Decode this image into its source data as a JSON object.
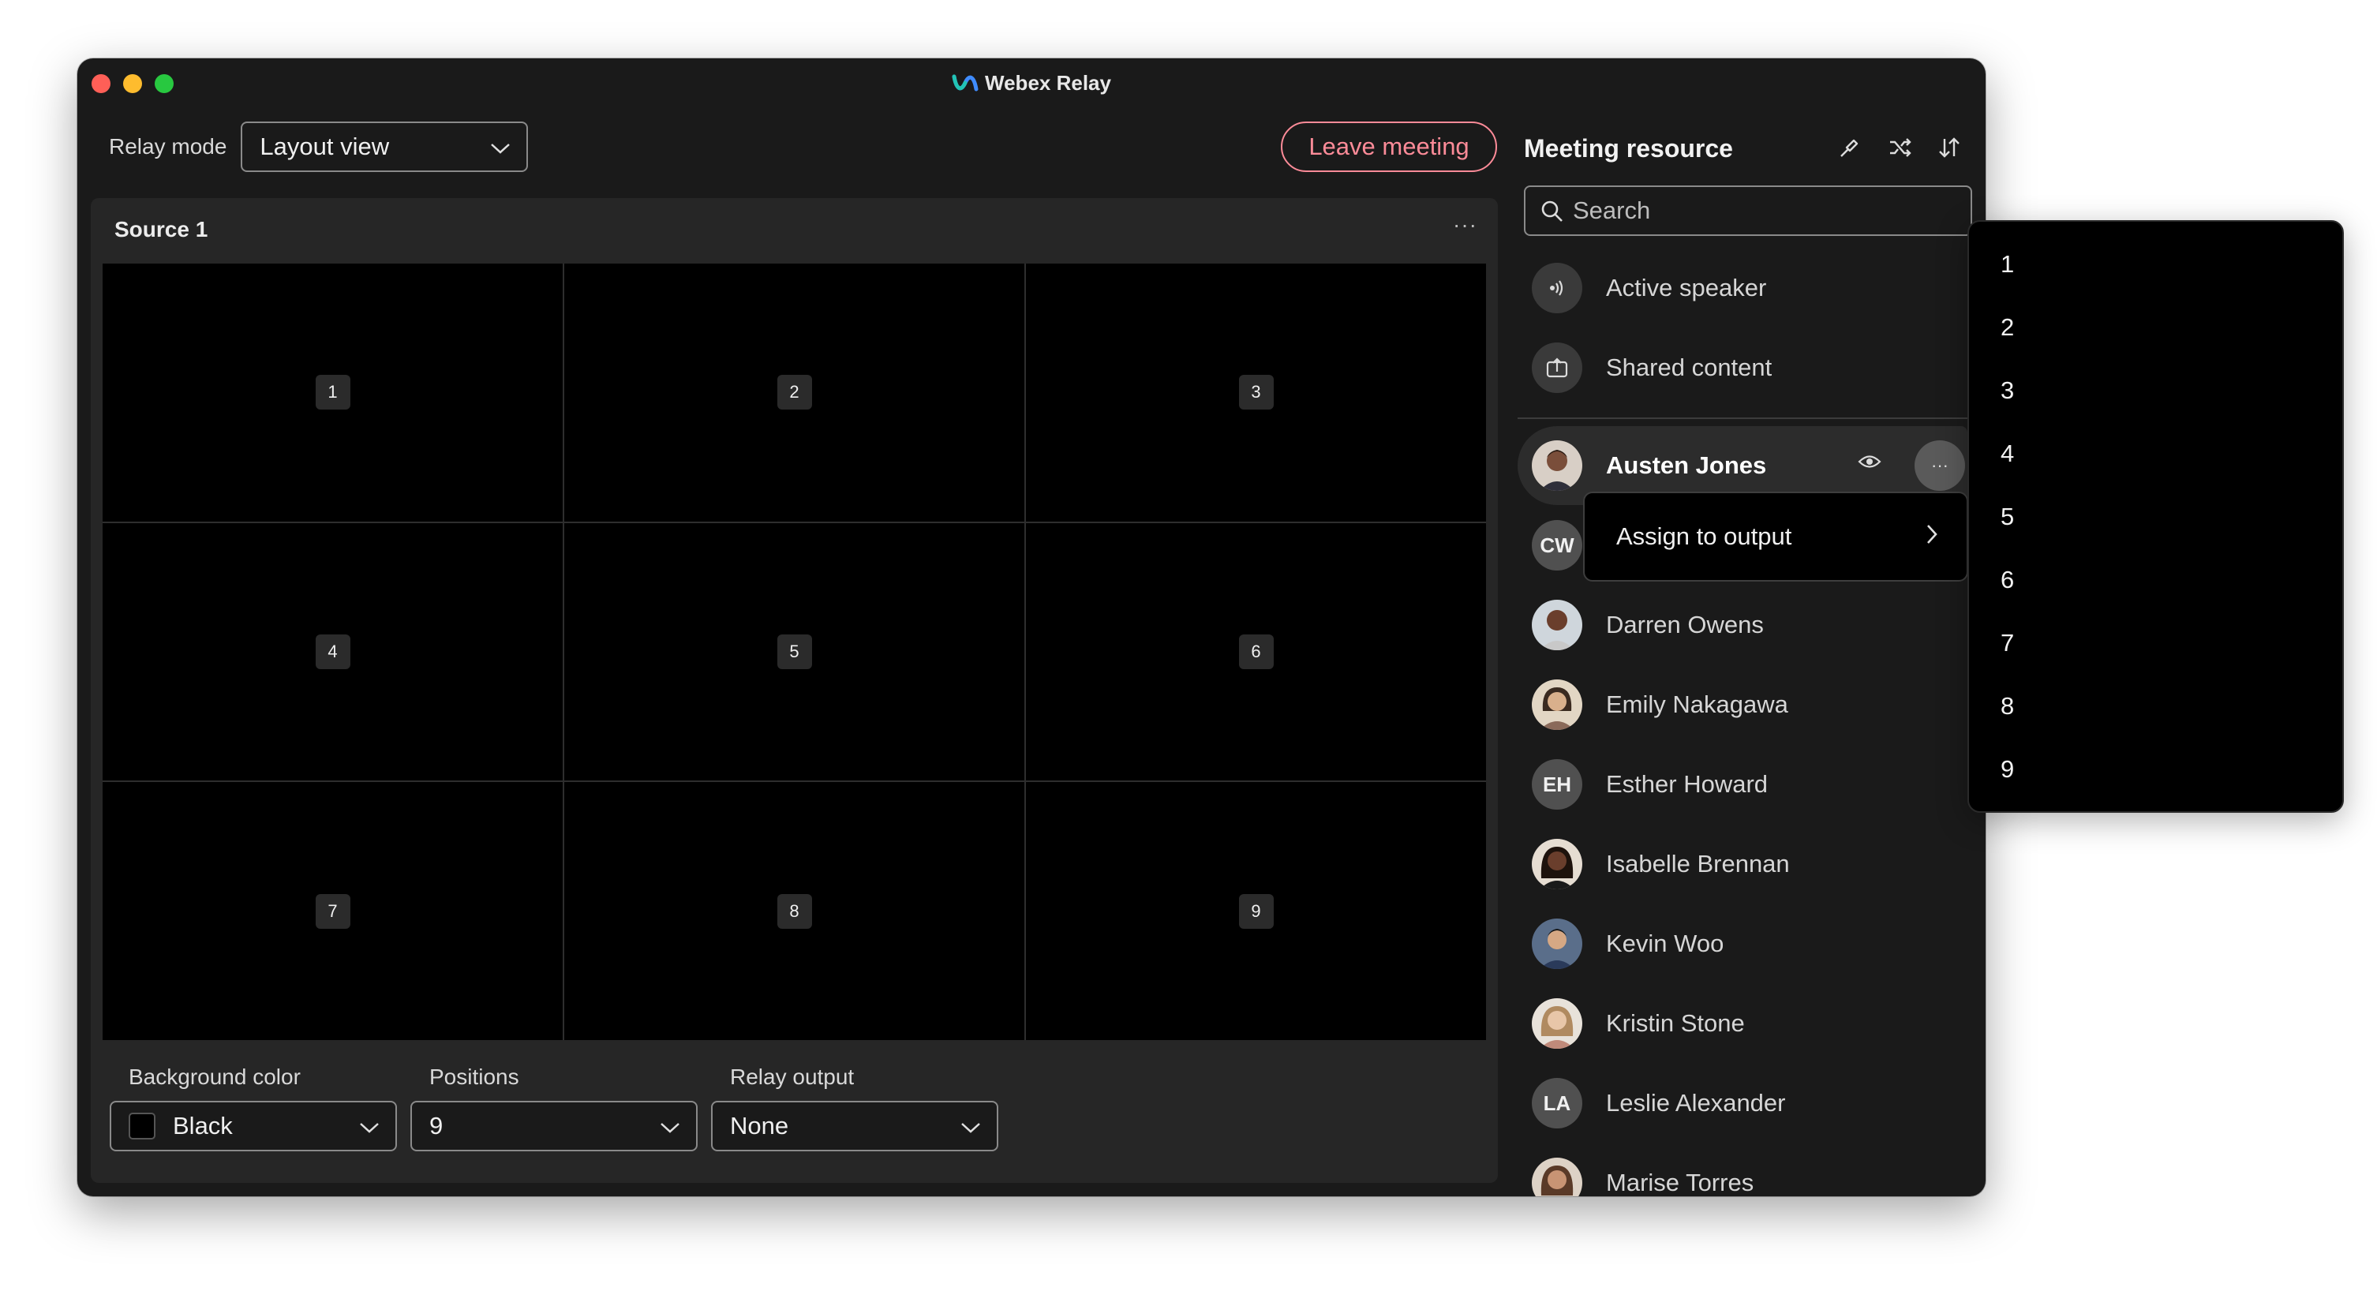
{
  "window": {
    "title": "Webex Relay"
  },
  "toolbar": {
    "relay_mode_label": "Relay mode",
    "relay_mode_value": "Layout view",
    "leave_label": "Leave meeting"
  },
  "source": {
    "title": "Source 1",
    "more": "···",
    "cells": [
      "1",
      "2",
      "3",
      "4",
      "5",
      "6",
      "7",
      "8",
      "9"
    ]
  },
  "controls": {
    "background": {
      "label": "Background color",
      "value": "Black",
      "swatch": "#000000"
    },
    "positions": {
      "label": "Positions",
      "value": "9"
    },
    "relay_output": {
      "label": "Relay output",
      "value": "None"
    }
  },
  "resource_panel": {
    "title": "Meeting resource",
    "search_placeholder": "Search",
    "items": [
      {
        "label": "Active speaker",
        "icon": "speaker-icon"
      },
      {
        "label": "Shared content",
        "icon": "share-icon"
      }
    ],
    "participants": [
      {
        "name": "Austen Jones",
        "initials": "",
        "avatar_color": "#6b4a3a"
      },
      {
        "name": "",
        "initials": "CW",
        "avatar_color": "#505050"
      },
      {
        "name": "Darren Owens",
        "initials": "",
        "avatar_color": "#5a3a2a"
      },
      {
        "name": "Emily Nakagawa",
        "initials": "",
        "avatar_color": "#b08a6a"
      },
      {
        "name": "Esther Howard",
        "initials": "EH",
        "avatar_color": "#505050"
      },
      {
        "name": "Isabelle Brennan",
        "initials": "",
        "avatar_color": "#4a2a20"
      },
      {
        "name": "Kevin Woo",
        "initials": "",
        "avatar_color": "#3a4a6a"
      },
      {
        "name": "Kristin Stone",
        "initials": "",
        "avatar_color": "#c0a080"
      },
      {
        "name": "Leslie Alexander",
        "initials": "LA",
        "avatar_color": "#505050"
      },
      {
        "name": "Marise Torres",
        "initials": "",
        "avatar_color": "#a07a60"
      }
    ],
    "more": "···"
  },
  "context_menu": {
    "assign_label": "Assign to output"
  },
  "output_menu": {
    "items": [
      "1",
      "2",
      "3",
      "4",
      "5",
      "6",
      "7",
      "8",
      "9"
    ]
  },
  "colors": {
    "accent_leave": "#fc8b98",
    "window_bg": "#1a1a1a",
    "panel_bg": "#262626"
  }
}
